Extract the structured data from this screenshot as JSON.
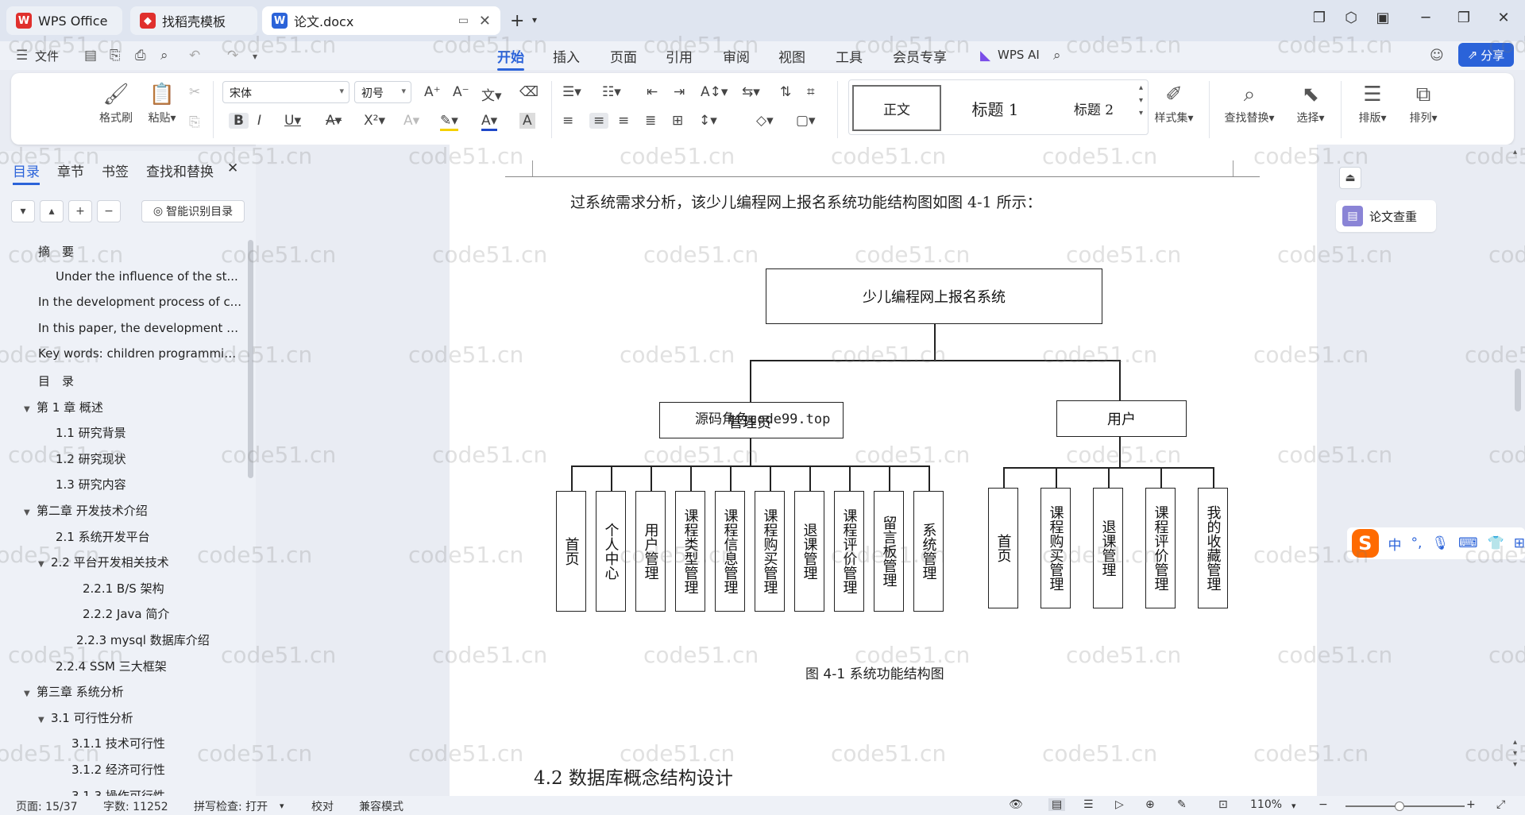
{
  "tabs": [
    {
      "label": "WPS Office"
    },
    {
      "label": "找稻壳模板"
    },
    {
      "label": "论文.docx"
    }
  ],
  "menu": {
    "file": "文件",
    "items": [
      "开始",
      "插入",
      "页面",
      "引用",
      "审阅",
      "视图",
      "工具",
      "会员专享"
    ],
    "active": "开始",
    "wps_ai": "WPS AI",
    "share": "分享"
  },
  "ribbon": {
    "format_painter": "格式刷",
    "paste": "粘贴",
    "font_name": "宋体",
    "font_size": "初号",
    "styles": {
      "normal": "正文",
      "h1": "标题 1",
      "h2": "标题 2"
    },
    "style_set": "样式集",
    "find_replace": "查找替换",
    "select": "选择",
    "layout": "排版",
    "arrange": "排列"
  },
  "sidebar": {
    "tabs": [
      "目录",
      "章节",
      "书签",
      "查找和替换"
    ],
    "active_tab": "目录",
    "smart_toc": "智能识别目录",
    "items": [
      {
        "text": "摘　要",
        "arrow": ""
      },
      {
        "text": "Under the influence of the st...",
        "arrow": ""
      },
      {
        "text": "In the development process of c...",
        "arrow": ""
      },
      {
        "text": "In this paper, the development b...",
        "arrow": ""
      },
      {
        "text": "Key words: children programmin...",
        "arrow": ""
      },
      {
        "text": "目　录",
        "arrow": ""
      },
      {
        "text": "第 1 章  概述",
        "arrow": "▼"
      },
      {
        "text": "1.1  研究背景",
        "arrow": ""
      },
      {
        "text": "1.2  研究现状",
        "arrow": ""
      },
      {
        "text": "1.3  研究内容",
        "arrow": ""
      },
      {
        "text": "第二章  开发技术介绍",
        "arrow": "▼"
      },
      {
        "text": "2.1    系统开发平台",
        "arrow": ""
      },
      {
        "text": "2.2  平台开发相关技术",
        "arrow": "▼"
      },
      {
        "text": "2.2.1    B/S 架构",
        "arrow": ""
      },
      {
        "text": "2.2.2    Java 简介",
        "arrow": ""
      },
      {
        "text": "2.2.3 mysql 数据库介绍",
        "arrow": ""
      },
      {
        "text": "2.2.4 SSM 三大框架",
        "arrow": ""
      },
      {
        "text": "第三章  系统分析",
        "arrow": "▼"
      },
      {
        "text": "3.1  可行性分析",
        "arrow": "▼"
      },
      {
        "text": "3.1.1    技术可行性",
        "arrow": ""
      },
      {
        "text": "3.1.2  经济可行性",
        "arrow": ""
      },
      {
        "text": "3.1.3  操作可行性",
        "arrow": ""
      }
    ]
  },
  "document": {
    "intro": "过系统需求分析，该少儿编程网上报名系统功能结构图如图 4-1 所示：",
    "diagram": {
      "root": "少儿编程网上报名系统",
      "admin": "管理员",
      "admin_overlay": "源码角色code99.top",
      "user": "用户",
      "admin_children": [
        "首页",
        "个人中心",
        "用户管理",
        "课程类型管理",
        "课程信息管理",
        "课程购买管理",
        "退课管理",
        "课程评价管理",
        "留言板管理",
        "系统管理"
      ],
      "user_children": [
        "首页",
        "课程购买管理",
        "退课管理",
        "课程评价管理",
        "我的收藏管理"
      ]
    },
    "caption": "图 4-1  系统功能结构图",
    "heading": "4.2  数据库概念结构设计"
  },
  "right_panel": {
    "essay_check": "论文查重",
    "ime_lang": "中"
  },
  "status": {
    "page": "页面: 15/37",
    "words": "字数: 11252",
    "spell": "拼写检查: 打开",
    "proof": "校对",
    "compat": "兼容模式",
    "zoom": "110%"
  },
  "watermark": "code51.cn",
  "colors": {
    "accent": "#2b63d9",
    "wps_red": "#e0302d"
  }
}
